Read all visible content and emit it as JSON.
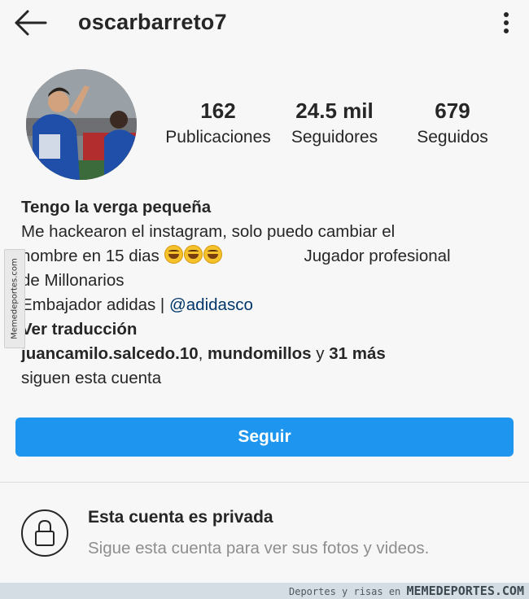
{
  "header": {
    "username": "oscarbarreto7"
  },
  "stats": [
    {
      "value": "162",
      "label": "Publicaciones"
    },
    {
      "value": "24.5 mil",
      "label": "Seguidores"
    },
    {
      "value": "679",
      "label": "Seguidos"
    }
  ],
  "bio": {
    "name": "Tengo la verga pequeña",
    "line1": "Me hackearon el instagram, solo puedo cambiar el",
    "line2_start": "nombre en 15 dias ",
    "line2_end": "Jugador profesional",
    "line3": "de Millonarios",
    "line4_start": "Embajador adidas | ",
    "mention": "@adidasco",
    "translate": "Ver traducción",
    "followers_user1": "juancamilo.salcedo.10",
    "followers_sep": ", ",
    "followers_user2": "mundomillos",
    "followers_and": " y ",
    "followers_more": "31 más",
    "followers_line2": "siguen esta cuenta"
  },
  "follow_button": {
    "label": "Seguir"
  },
  "private": {
    "title": "Esta cuenta es privada",
    "subtitle": "Sigue esta cuenta para ver sus fotos y videos."
  },
  "watermark": {
    "side": "Memedeportes.com",
    "footer_prefix": "Deportes y risas en ",
    "footer_brand": "MEMEDEPORTES.COM"
  },
  "icons": {
    "back": "arrow-left-icon",
    "more": "more-vertical-icon",
    "lock": "lock-icon"
  },
  "colors": {
    "primary_button": "#1e96f0",
    "mention": "#00376b",
    "secondary_text": "#8e8e8e"
  }
}
